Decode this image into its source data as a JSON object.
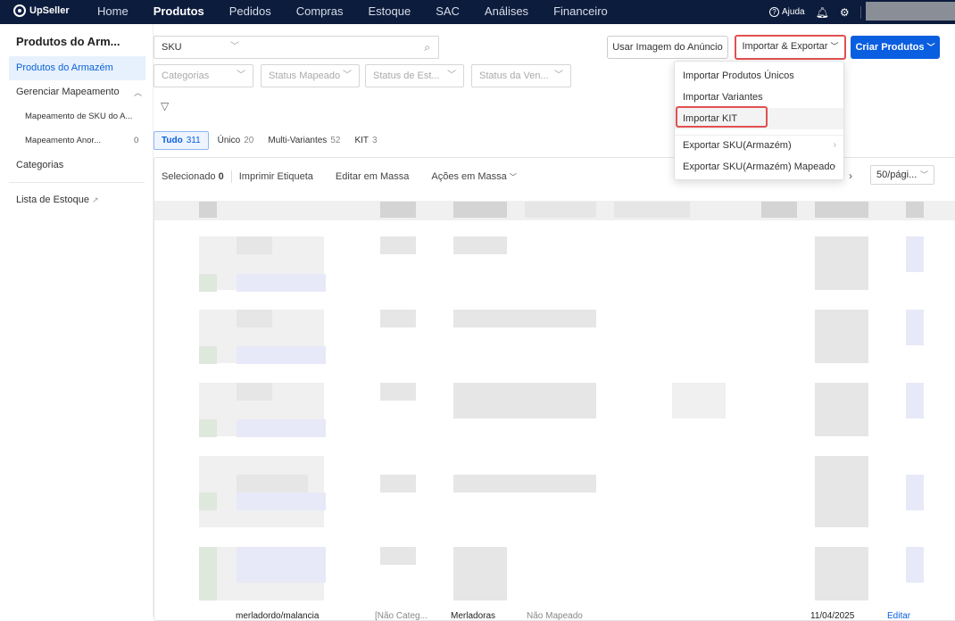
{
  "brand": {
    "name": "UpSeller"
  },
  "nav": [
    "Home",
    "Produtos",
    "Pedidos",
    "Compras",
    "Estoque",
    "SAC",
    "Análises",
    "Financeiro"
  ],
  "topbar": {
    "help": "Ajuda"
  },
  "sidebar": {
    "title": "Produtos do Arm...",
    "items": {
      "produtos": "Produtos do Armazém",
      "gerenciar": "Gerenciar Mapeamento",
      "sub1": "Mapeamento de SKU do A...",
      "sub2": "Mapeamento Anor...",
      "sub2_count": "0",
      "categorias": "Categorias",
      "lista": "Lista de Estoque"
    }
  },
  "filters": {
    "sku_type": "SKU",
    "categorias": "Categorias",
    "status_mapeado": "Status Mapeado",
    "status_estoque": "Status de Est...",
    "status_venda": "Status da Ven..."
  },
  "buttons": {
    "usar_imagem": "Usar Imagem do Anúncio",
    "importar_exportar": "Importar & Exportar",
    "criar": "Criar Produtos"
  },
  "tabs": [
    {
      "label": "Tudo",
      "count": "311"
    },
    {
      "label": "Único",
      "count": "20"
    },
    {
      "label": "Multi-Variantes",
      "count": "52"
    },
    {
      "label": "KIT",
      "count": "3"
    }
  ],
  "toolbar": {
    "selected_label": "Selecionado",
    "selected_count": "0",
    "imprimir": "Imprimir Etiqueta",
    "editar": "Editar em Massa",
    "acoes": "Ações em Massa",
    "page_size": "50/pági..."
  },
  "dropdown": {
    "items": [
      "Importar Produtos Únicos",
      "Importar Variantes",
      "Importar KIT",
      "Exportar SKU(Armazém)",
      "Exportar SKU(Armazém) Mapeado"
    ]
  },
  "bottom_row": {
    "sku": "merladordo/malancia",
    "cat": "[Não Categ...",
    "name": "Merladoras",
    "status": "Não Mapeado",
    "date": "11/04/2025",
    "action": "Editar"
  },
  "colors": {
    "topbar": "#0c1c3d",
    "primary": "#0a5ee0",
    "highlight": "#e25050"
  }
}
